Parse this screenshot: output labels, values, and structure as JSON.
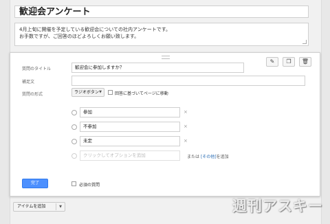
{
  "form": {
    "title": "歓迎会アンケート",
    "description_line1": "4月上旬に開催を予定している歓迎会についての社内アンケートです。",
    "description_line2": "お手数ですが、ご回答のほどよろしくお願い致します。"
  },
  "question_editor": {
    "toolbar": {
      "edit_icon": "pencil-icon",
      "duplicate_icon": "copy-icon",
      "delete_icon": "trash-icon"
    },
    "title_label": "質問のタイトル",
    "title_value": "歓迎会に参加しますか？",
    "help_label": "補足文",
    "help_value": "",
    "type_label": "質問の形式",
    "type_value": "ラジオボタン",
    "goto_page_label": "回答に基づいてページに移動",
    "options": [
      {
        "value": "参加"
      },
      {
        "value": "不参加"
      },
      {
        "value": "未定"
      }
    ],
    "add_option_placeholder": "クリックしてオプションを追加",
    "other_prefix": "または",
    "other_link": "[その他]",
    "other_suffix": "を追加",
    "done_label": "完了",
    "required_label": "必須の質問"
  },
  "footer": {
    "add_item_label": "アイテムを追加"
  },
  "watermark": "週刊アスキー"
}
